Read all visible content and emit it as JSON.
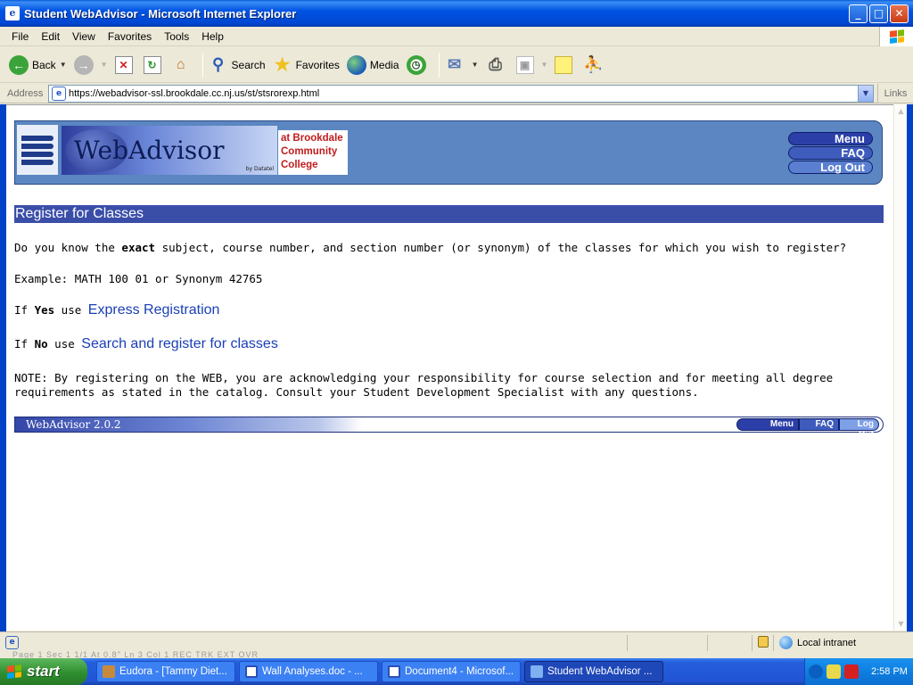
{
  "window": {
    "title": "Student WebAdvisor - Microsoft Internet Explorer",
    "buttons": {
      "minimize": "_",
      "maximize": "□",
      "close": "✕"
    }
  },
  "menubar": [
    "File",
    "Edit",
    "View",
    "Favorites",
    "Tools",
    "Help"
  ],
  "toolbar": {
    "back": "Back",
    "search": "Search",
    "favorites": "Favorites",
    "media": "Media"
  },
  "address": {
    "label": "Address",
    "url": "https://webadvisor-ssl.brookdale.cc.nj.us/st/stsrorexp.html",
    "links": "Links"
  },
  "header": {
    "brand": "WebAdvisor",
    "brand_by": "by Datatel",
    "college_line1": "at Brookdale",
    "college_line2": "Community",
    "college_line3": "College",
    "nav": {
      "menu": "Menu",
      "faq": "FAQ",
      "logout": "Log Out"
    }
  },
  "page": {
    "section_title": "Register for Classes",
    "question_pre": "Do you know the ",
    "question_bold": "exact",
    "question_post": " subject, course number, and section number (or synonym) of the classes for which you wish to register?",
    "example": "Example: MATH 100 01 or Synonym 42765",
    "if_label": "If ",
    "yes": "Yes",
    "no": "No",
    "use": " use ",
    "express_link": "Express Registration",
    "search_link": "Search and register for classes",
    "note": "NOTE: By registering on the WEB, you are acknowledging your responsibility for course selection and for meeting all degree requirements as stated in the catalog. Consult your Student Development Specialist with any questions."
  },
  "footer": {
    "version": "WebAdvisor  2.0.2",
    "nav": {
      "menu": "Menu",
      "faq": "FAQ",
      "logout": "Log Out"
    }
  },
  "statusbar": {
    "ghost_text": "Page 1     Sec 1     1/1     At 0.8\"     Ln 3     Col 1     REC  TRK  EXT  OVR",
    "zone": "Local intranet"
  },
  "taskbar": {
    "start": "start",
    "tasks": [
      "Eudora - [Tammy Diet...",
      "Wall Analyses.doc - ...",
      "Document4 - Microsof...",
      "Student WebAdvisor ..."
    ],
    "clock": "2:58 PM"
  },
  "colors": {
    "accent_blue": "#3a4ea8",
    "link": "#1a3fb5",
    "header_bg": "#5b86c1",
    "college_red": "#c21c1c"
  }
}
